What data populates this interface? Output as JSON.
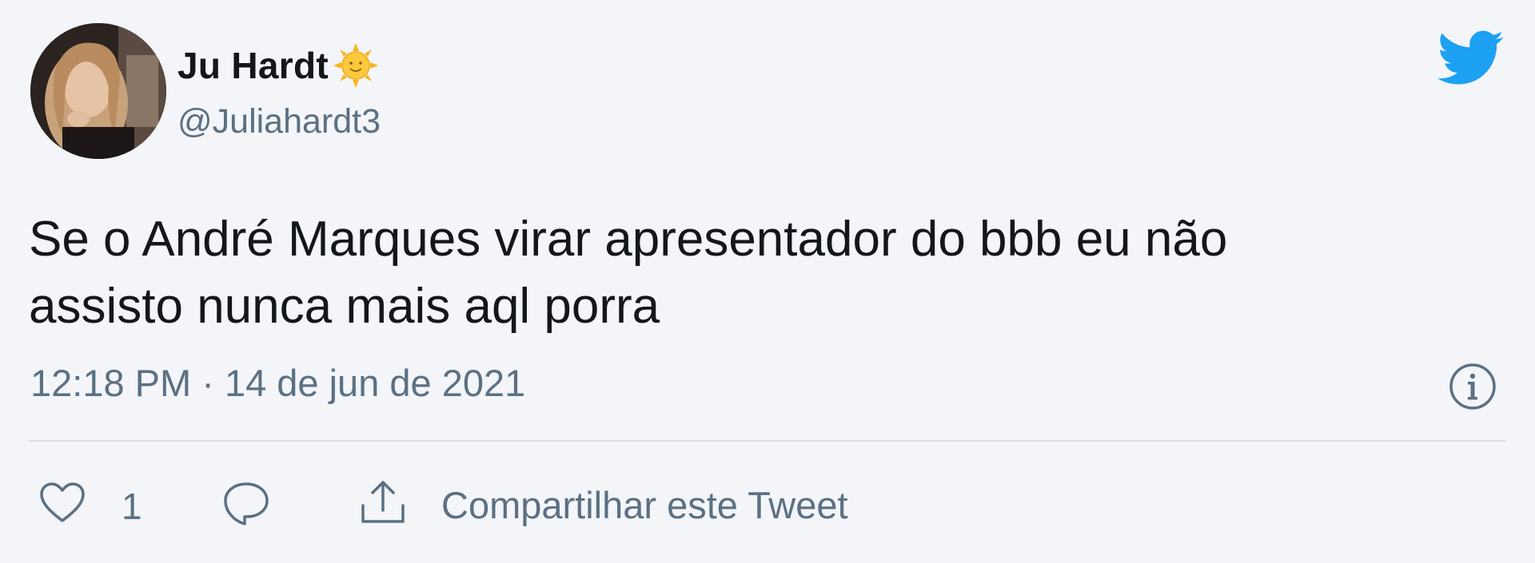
{
  "author": {
    "display_name": "Ju Hardt",
    "name_emoji": "sun-with-face-emoji",
    "handle": "@Juliahardt3",
    "avatar": "profile-photo"
  },
  "tweet": {
    "text_lines": [
      "Se o André Marques virar apresentador do bbb eu não",
      "assisto nunca mais aql porra"
    ],
    "timestamp": "12:18 PM · 14 de jun de 2021"
  },
  "actions": {
    "like_count": "1",
    "share_label": "Compartilhar este Tweet"
  },
  "icons": {
    "brand": "twitter-bird-icon",
    "info": "info-icon",
    "like": "heart-icon",
    "reply": "speech-bubble-icon",
    "share": "share-upload-icon"
  },
  "colors": {
    "background": "#f3f5f8",
    "text": "#14171a",
    "muted": "#5b7083",
    "twitter_blue": "#1da1f2",
    "divider": "#d8dee4"
  }
}
